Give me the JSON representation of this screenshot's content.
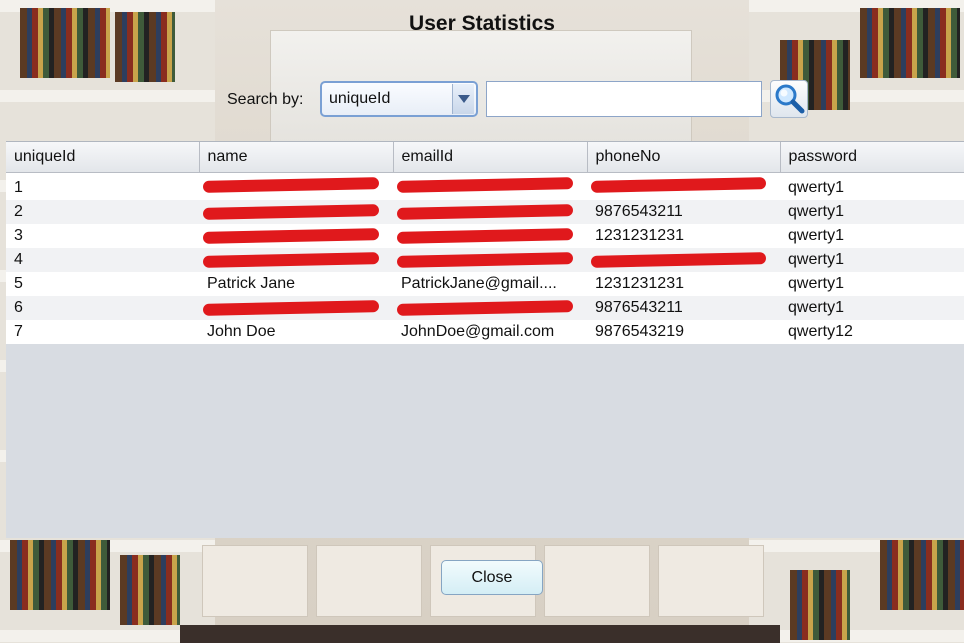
{
  "window": {
    "title": "User Statistics"
  },
  "search": {
    "label": "Search by:",
    "selected_field": "uniqueId",
    "value": "",
    "icon": "magnifier-icon"
  },
  "table": {
    "columns": [
      "uniqueId",
      "name",
      "emailId",
      "phoneNo",
      "password"
    ],
    "rows": [
      {
        "uniqueId": "1",
        "name": "",
        "emailId": "",
        "phoneNo": "",
        "password": "qwerty1",
        "redacted": [
          "name",
          "emailId",
          "phoneNo"
        ]
      },
      {
        "uniqueId": "2",
        "name": "",
        "emailId": "",
        "phoneNo": "9876543211",
        "password": "qwerty1",
        "redacted": [
          "name",
          "emailId"
        ]
      },
      {
        "uniqueId": "3",
        "name": "",
        "emailId": "",
        "phoneNo": "1231231231",
        "password": "qwerty1",
        "redacted": [
          "name",
          "emailId"
        ]
      },
      {
        "uniqueId": "4",
        "name": "",
        "emailId": "",
        "phoneNo": "",
        "password": "qwerty1",
        "redacted": [
          "name",
          "emailId",
          "phoneNo"
        ]
      },
      {
        "uniqueId": "5",
        "name": "Patrick Jane",
        "emailId": "PatrickJane@gmail....",
        "phoneNo": "1231231231",
        "password": "qwerty1",
        "redacted": []
      },
      {
        "uniqueId": "6",
        "name": "",
        "emailId": "",
        "phoneNo": "9876543211",
        "password": "qwerty1",
        "redacted": [
          "name",
          "emailId"
        ]
      },
      {
        "uniqueId": "7",
        "name": "John Doe",
        "emailId": "JohnDoe@gmail.com",
        "phoneNo": "9876543219",
        "password": "qwerty12",
        "redacted": []
      }
    ]
  },
  "actions": {
    "close_label": "Close"
  },
  "colors": {
    "redaction": "#e0191c",
    "button_bg": "#d4eef5",
    "combo_border": "#7aa0d4"
  }
}
